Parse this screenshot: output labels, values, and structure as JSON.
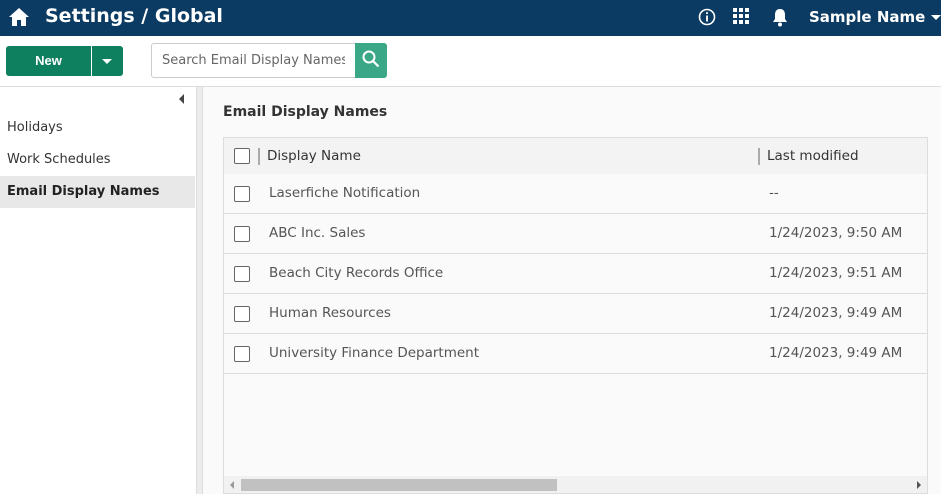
{
  "header": {
    "title": "Settings / Global",
    "user_name": "Sample Name",
    "icons": [
      "home-icon",
      "info-icon",
      "apps-grid-icon",
      "bell-icon",
      "caret-down-icon"
    ],
    "bg_color": "#0b3a62"
  },
  "toolbar": {
    "new_label": "New",
    "search_placeholder": "Search Email Display Names",
    "accent": "#0e7f5f"
  },
  "sidebar": {
    "items": [
      {
        "label": "Holidays"
      },
      {
        "label": "Work Schedules"
      },
      {
        "label": "Email Display Names",
        "active": true
      }
    ]
  },
  "main": {
    "heading": "Email Display Names",
    "columns": [
      "Display Name",
      "Last modified"
    ],
    "rows": [
      {
        "name": "Laserfiche Notification",
        "modified": "--"
      },
      {
        "name": "ABC Inc. Sales",
        "modified": "1/24/2023, 9:50 AM"
      },
      {
        "name": "Beach City Records Office",
        "modified": "1/24/2023, 9:51 AM"
      },
      {
        "name": "Human Resources",
        "modified": "1/24/2023, 9:49 AM"
      },
      {
        "name": "University Finance Department",
        "modified": "1/24/2023, 9:49 AM"
      }
    ]
  }
}
